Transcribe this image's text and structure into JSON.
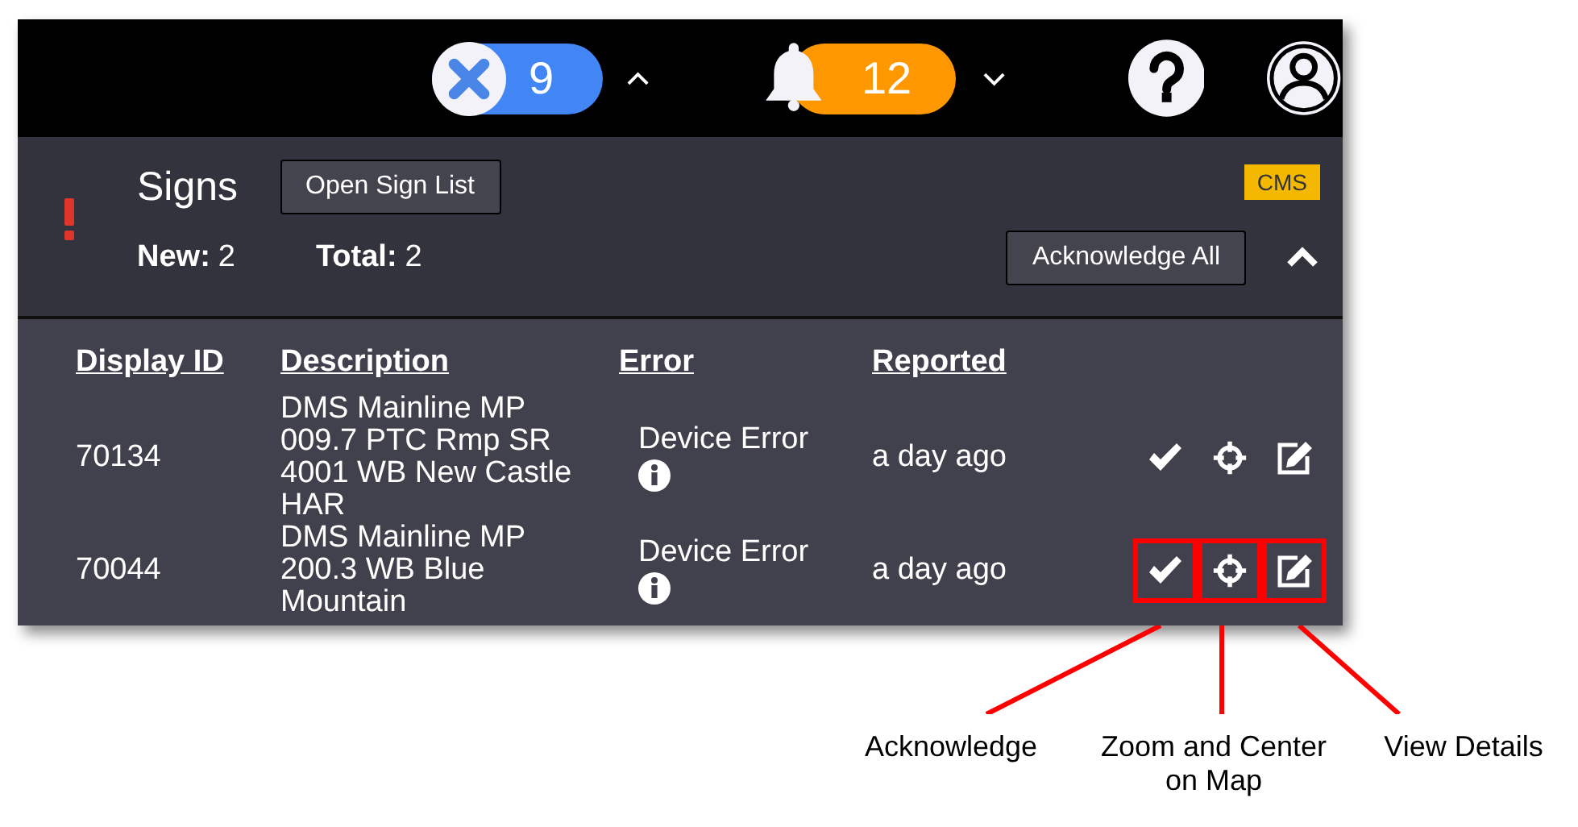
{
  "top_bar": {
    "error_count": "9",
    "error_menu_expanded": true,
    "notification_count": "12",
    "notification_menu_expanded": false
  },
  "panel": {
    "title": "Signs",
    "open_button": "Open Sign List",
    "badge": "CMS",
    "new_label": "New:",
    "new_value": "2",
    "total_label": "Total:",
    "total_value": "2",
    "acknowledge_all": "Acknowledge All",
    "expanded": true
  },
  "table": {
    "columns": [
      "Display ID",
      "Description",
      "Error",
      "Reported"
    ],
    "rows": [
      {
        "display_id": "70134",
        "description": "DMS Mainline MP 009.7 PTC Rmp SR 4001 WB New Castle HAR",
        "error": "Device Error",
        "reported": "a day ago",
        "highlighted": false
      },
      {
        "display_id": "70044",
        "description": "DMS Mainline MP 200.3 WB Blue Mountain",
        "error": "Device Error",
        "reported": "a day ago",
        "highlighted": true
      }
    ]
  },
  "callouts": [
    {
      "label": "Acknowledge"
    },
    {
      "label": "Zoom and Center on Map"
    },
    {
      "label": "View Details"
    }
  ]
}
